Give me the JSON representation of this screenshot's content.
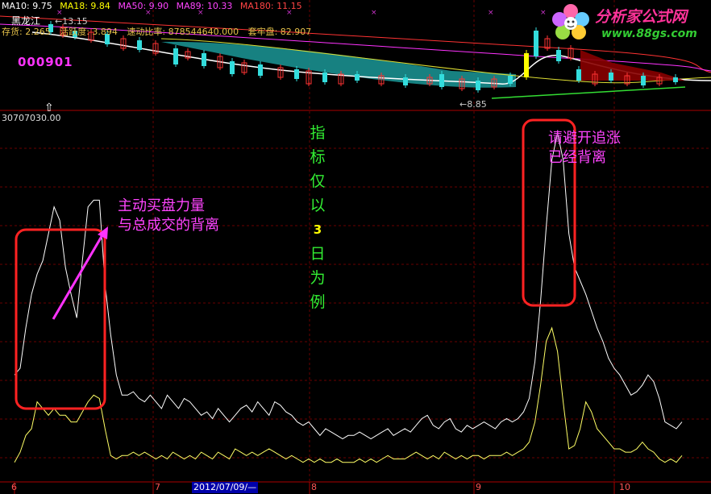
{
  "ma_bar": [
    {
      "label": "MA10: 9.75",
      "color": "#ffffff"
    },
    {
      "label": "MA18: 9.84",
      "color": "#ffff00"
    },
    {
      "label": "MA50: 9.90",
      "color": "#ff44ff"
    },
    {
      "label": "MA89: 10.33",
      "color": "#ff44ff"
    },
    {
      "label": "MA180: 11.15",
      "color": "#ff4444"
    }
  ],
  "stock_name": "黑龙江",
  "high_price": "13.15",
  "low_price": "8.85",
  "info_bar": [
    "存货: 2.265",
    "活跃度: 3.894",
    "速动比率: 878544640.000",
    "套牢盘: 82.907"
  ],
  "stock_code": "000901",
  "indicator_value": "30707030.00",
  "annotations": {
    "left_note": [
      "主动买盘力量",
      "与总成交的背离"
    ],
    "right_note": [
      "请避开追涨",
      "已经背离"
    ],
    "vertical_note": [
      "指",
      "标",
      "仅",
      "以",
      "3",
      "日",
      "为",
      "例"
    ]
  },
  "x_axis": {
    "labels": [
      "6",
      "7",
      "8",
      "9",
      "10"
    ],
    "cursor_date": "2012/07/09/—"
  },
  "logo": {
    "title": "分析家公式网",
    "url": "www.88gs.com"
  },
  "colors": {
    "annotation": "#ff44ff",
    "vertical_note": "#33ee33",
    "box": "#ff2222",
    "arrow": "#ff33ff",
    "upper_line": "#ffffff",
    "lower_line": "#ffff66"
  },
  "chart_data": {
    "type": "line",
    "series": [
      {
        "values": [
          0.28,
          0.3,
          0.42,
          0.52,
          0.58,
          0.62,
          0.7,
          0.78,
          0.74,
          0.6,
          0.52,
          0.45,
          0.62,
          0.78,
          0.8,
          0.8,
          0.55,
          0.4,
          0.28,
          0.22,
          0.22,
          0.23,
          0.21,
          0.2,
          0.22,
          0.2,
          0.18,
          0.22,
          0.2,
          0.18,
          0.21,
          0.2,
          0.18,
          0.16,
          0.17,
          0.15,
          0.18,
          0.16,
          0.14,
          0.16,
          0.18,
          0.19,
          0.17,
          0.2,
          0.18,
          0.16,
          0.2,
          0.19,
          0.17,
          0.16,
          0.14,
          0.13,
          0.14,
          0.12,
          0.1,
          0.12,
          0.11,
          0.1,
          0.09,
          0.1,
          0.1,
          0.11,
          0.1,
          0.09,
          0.1,
          0.11,
          0.12,
          0.1,
          0.11,
          0.12,
          0.11,
          0.13,
          0.15,
          0.16,
          0.13,
          0.12,
          0.14,
          0.15,
          0.12,
          0.11,
          0.13,
          0.12,
          0.13,
          0.14,
          0.13,
          0.12,
          0.14,
          0.15,
          0.14,
          0.15,
          0.17,
          0.21,
          0.32,
          0.5,
          0.72,
          0.92,
          1.0,
          0.92,
          0.7,
          0.6,
          0.56,
          0.52,
          0.47,
          0.42,
          0.38,
          0.33,
          0.3,
          0.28,
          0.25,
          0.22,
          0.23,
          0.25,
          0.28,
          0.26,
          0.21,
          0.14,
          0.13,
          0.12,
          0.14
        ]
      },
      {
        "values": [
          0.02,
          0.05,
          0.1,
          0.12,
          0.2,
          0.18,
          0.16,
          0.18,
          0.16,
          0.16,
          0.14,
          0.14,
          0.17,
          0.2,
          0.22,
          0.21,
          0.12,
          0.04,
          0.03,
          0.04,
          0.04,
          0.05,
          0.04,
          0.05,
          0.04,
          0.03,
          0.04,
          0.03,
          0.05,
          0.04,
          0.03,
          0.04,
          0.03,
          0.05,
          0.04,
          0.03,
          0.05,
          0.04,
          0.03,
          0.06,
          0.05,
          0.04,
          0.05,
          0.04,
          0.05,
          0.06,
          0.05,
          0.04,
          0.03,
          0.04,
          0.03,
          0.02,
          0.03,
          0.02,
          0.03,
          0.02,
          0.02,
          0.03,
          0.02,
          0.02,
          0.02,
          0.03,
          0.02,
          0.03,
          0.02,
          0.03,
          0.04,
          0.03,
          0.03,
          0.03,
          0.04,
          0.05,
          0.04,
          0.03,
          0.04,
          0.03,
          0.05,
          0.04,
          0.03,
          0.04,
          0.03,
          0.04,
          0.04,
          0.03,
          0.04,
          0.04,
          0.04,
          0.05,
          0.04,
          0.05,
          0.06,
          0.08,
          0.14,
          0.25,
          0.38,
          0.42,
          0.35,
          0.2,
          0.06,
          0.07,
          0.12,
          0.2,
          0.17,
          0.12,
          0.1,
          0.08,
          0.06,
          0.06,
          0.05,
          0.05,
          0.06,
          0.08,
          0.06,
          0.05,
          0.03,
          0.02,
          0.03,
          0.02,
          0.04
        ]
      }
    ]
  }
}
